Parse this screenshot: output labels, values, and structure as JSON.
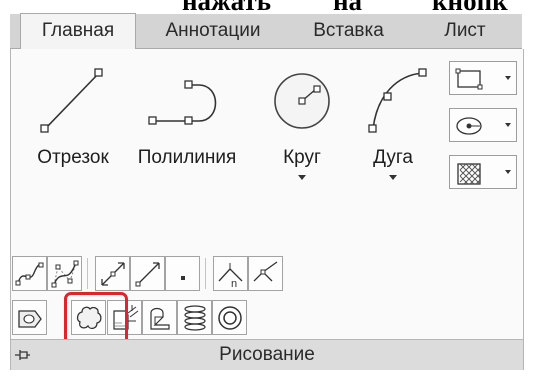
{
  "document_text": {
    "word1": "нажать",
    "word2": "на",
    "word3": "кнопк"
  },
  "tabs": [
    {
      "label": "Главная",
      "active": true
    },
    {
      "label": "Аннотации",
      "active": false
    },
    {
      "label": "Вставка",
      "active": false
    },
    {
      "label": "Лист",
      "active": false
    }
  ],
  "tools": [
    {
      "label": "Отрезок",
      "icon": "line-icon",
      "has_dropdown": false
    },
    {
      "label": "Полилиния",
      "icon": "polyline-icon",
      "has_dropdown": false
    },
    {
      "label": "Круг",
      "icon": "circle-icon",
      "has_dropdown": true
    },
    {
      "label": "Дуга",
      "icon": "arc-icon",
      "has_dropdown": true
    }
  ],
  "side_tools": [
    {
      "icon": "rectangle-icon"
    },
    {
      "icon": "ellipse-icon"
    },
    {
      "icon": "hatch-icon"
    }
  ],
  "row1_tools": [
    "spline-fit-icon",
    "spline-cv-icon",
    "construction-line-icon",
    "ray-icon",
    "point-icon",
    "divide-icon",
    "measure-icon"
  ],
  "row2_tools": [
    "region-icon",
    "revision-cloud-icon",
    "wipeout-icon",
    "3d-polyline-icon",
    "helix-icon",
    "donut-icon"
  ],
  "highlighted_tool": "revision-cloud-icon",
  "accent_color": "#e0252a",
  "panel_title": "Рисование"
}
